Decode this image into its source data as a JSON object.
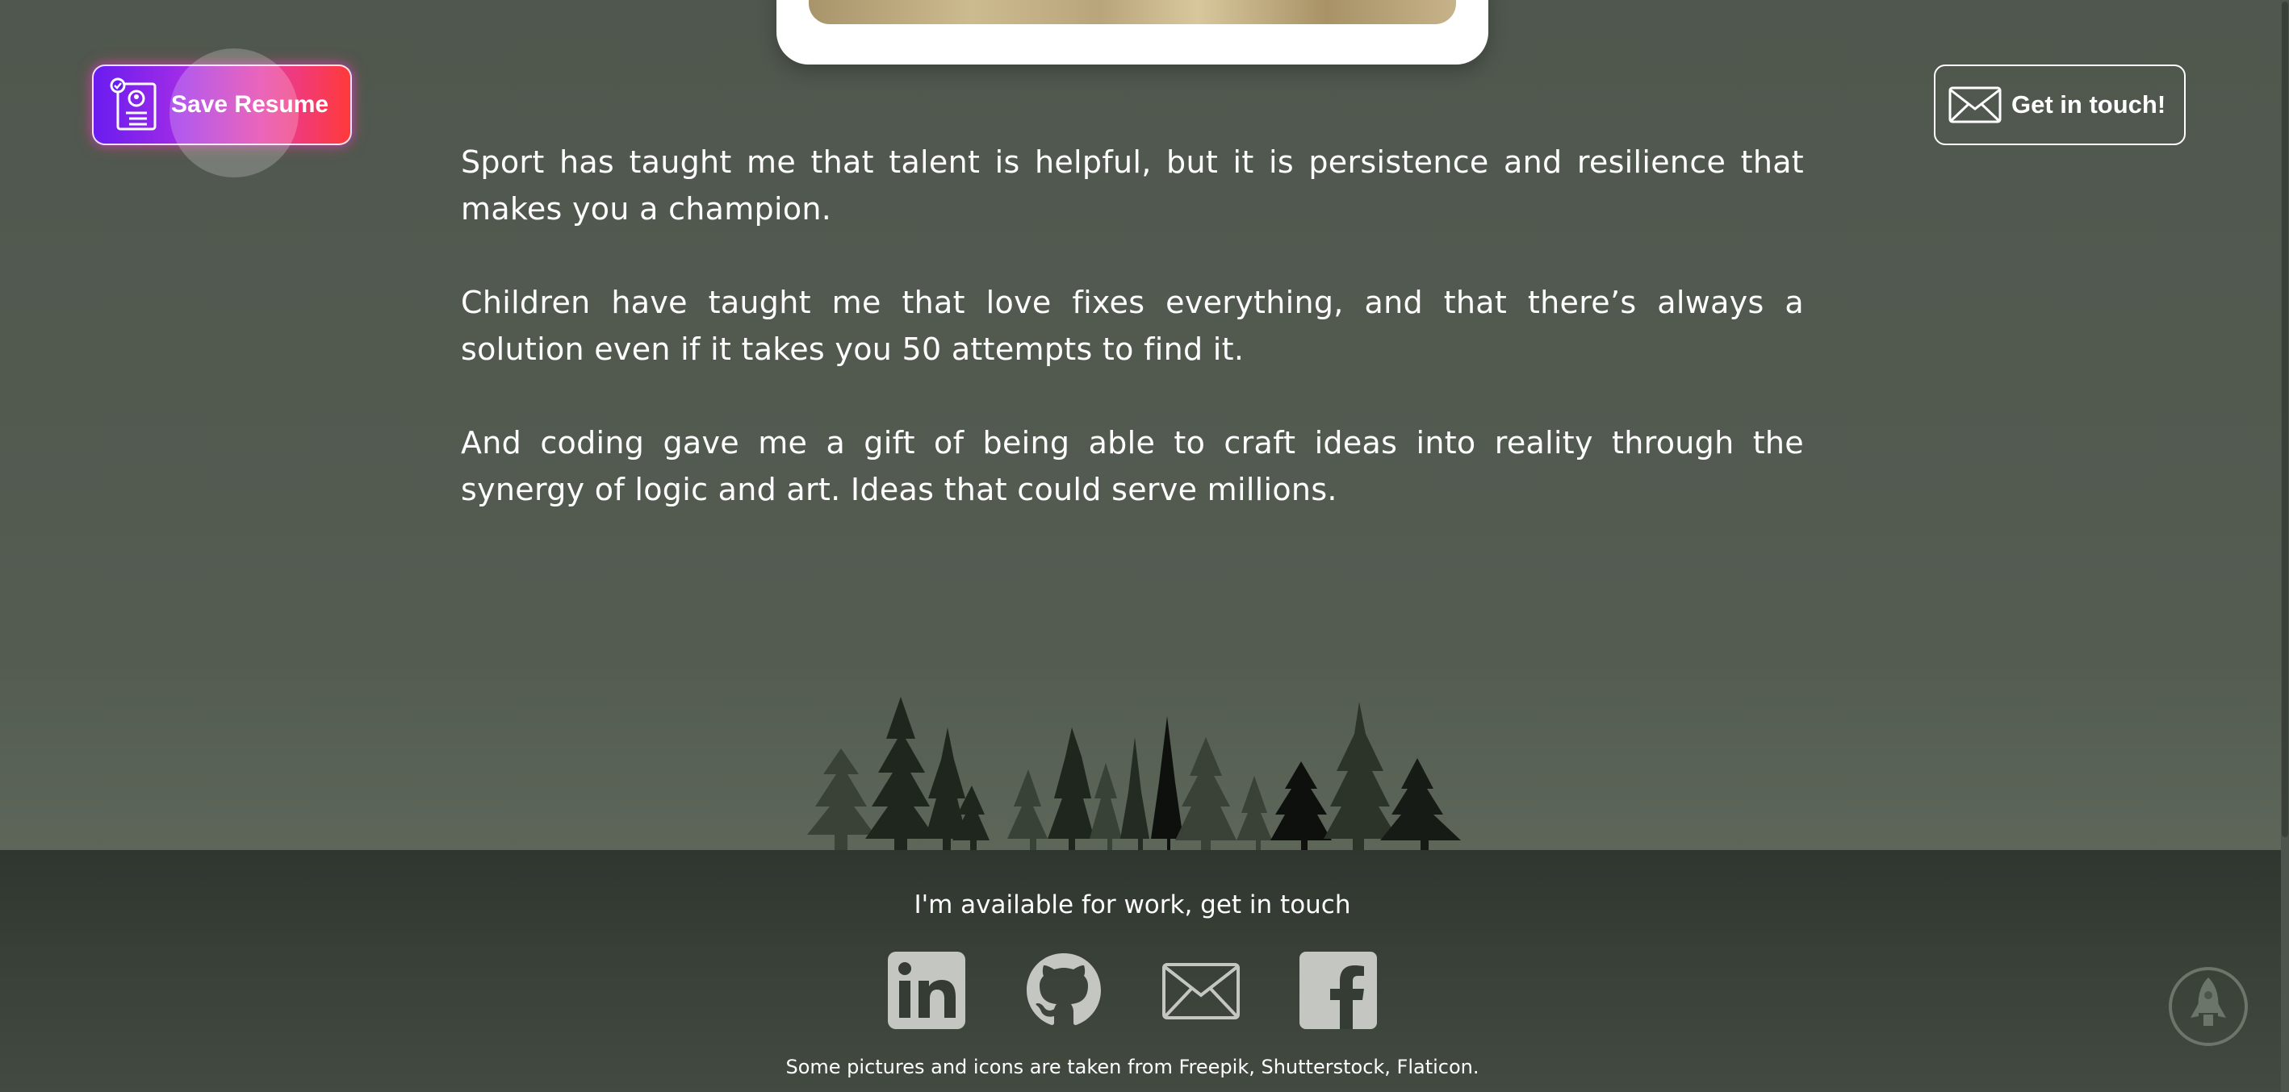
{
  "header": {
    "save_resume_label": "Save Resume",
    "get_in_touch_label": "Get in touch!"
  },
  "content": {
    "paragraphs": [
      "Sport has taught me that talent is helpful, but it is persistence and resilience that makes you a champion.",
      "Children have taught me that love fixes everything, and that there’s always a solution even if it takes you 50 attempts to find it.",
      "And coding gave me a gift of being able to craft ideas into reality through the synergy of logic and art. Ideas that could serve millions."
    ]
  },
  "footer": {
    "availability": "I'm available for work, get in touch",
    "social": [
      "linkedin-icon",
      "github-icon",
      "mail-icon",
      "facebook-icon"
    ],
    "credits": "Some pictures and icons are taken from Freepik, Shutterstock, Flaticon."
  },
  "colors": {
    "background": "#525a50",
    "footer": "#353c34",
    "resume_gradient_start": "#6a1cf0",
    "resume_gradient_end": "#ff3a3a",
    "icon_gray": "#c4c6c2"
  }
}
